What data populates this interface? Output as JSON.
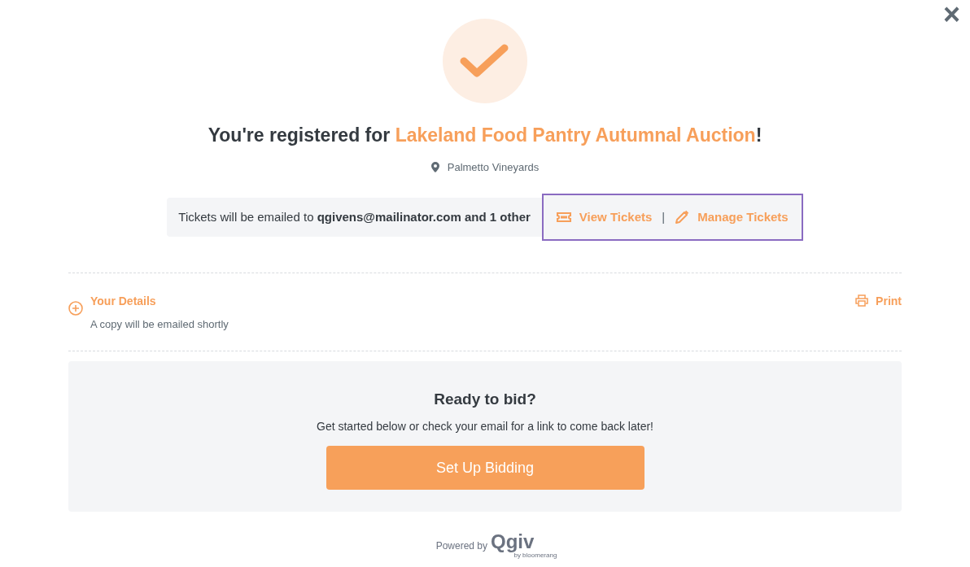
{
  "close_label": "×",
  "title": {
    "prefix": "You're registered for ",
    "event": "Lakeland Food Pantry Autumnal Auction",
    "suffix": "!"
  },
  "location": "Palmetto Vineyards",
  "tickets": {
    "message": "Tickets will be emailed to **qgivens@mailinator.com and 1 other**",
    "focused": true,
    "actions": [
      {
        "kind": "ticket",
        "label": "View Tickets"
      },
      {
        "kind": "pencil",
        "label": "Manage Tickets"
      }
    ],
    "separator": "|"
  },
  "details": {
    "title": "Your Details",
    "subtitle": "A copy will be emailed shortly",
    "expanded": false,
    "print": "Print"
  },
  "bidding": {
    "title": "Ready to bid?",
    "text": "Get started below or check your email for a link to come back later!",
    "button": "Set Up Bidding"
  },
  "footer": {
    "powered": "Powered by",
    "brand": "Qgiv",
    "sub": "by bloomerang"
  }
}
